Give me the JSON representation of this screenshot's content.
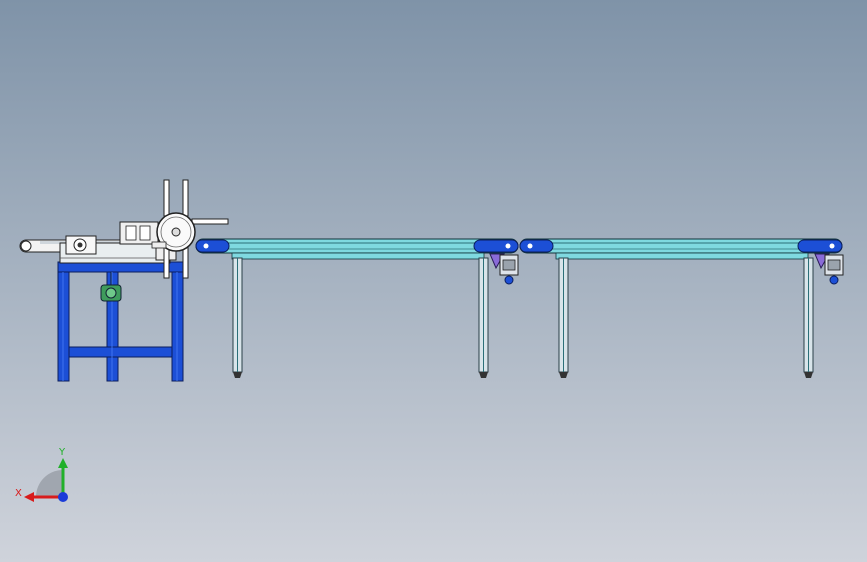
{
  "view": {
    "background_top": "#7f93a8",
    "background_bottom": "#cfd3db"
  },
  "colors": {
    "frame_blue": "#1c4fd6",
    "rail_cyan": "#7fd9e0",
    "rail_dark": "#2b6f78",
    "leg_gray": "#d8e4ea",
    "motor_purple": "#8a6bd8",
    "white_part": "#f2f2f2"
  },
  "triad": {
    "x_label": "X",
    "y_label": "Y",
    "x_color": "#d81b1b",
    "y_color": "#21b02a",
    "z_color": "#1a3bd8"
  },
  "icons": [
    "coordinate-triad-icon"
  ]
}
